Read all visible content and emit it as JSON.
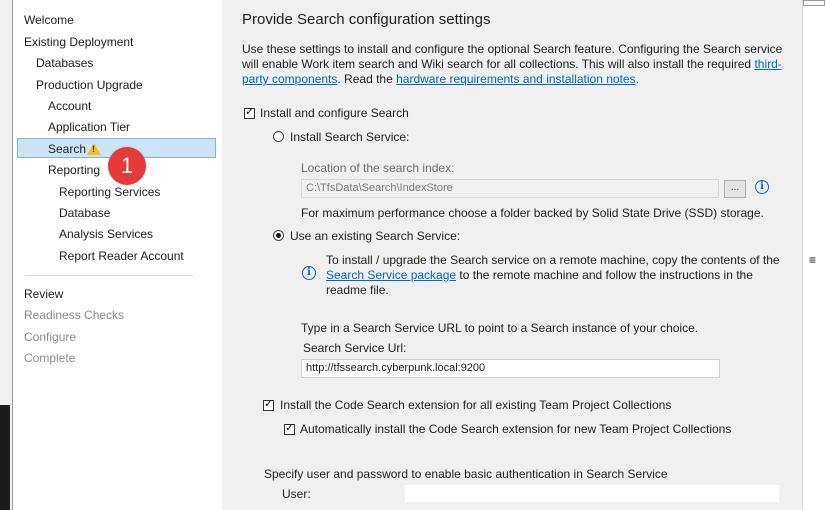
{
  "sidebar": {
    "items": [
      {
        "label": "Welcome"
      },
      {
        "label": "Existing Deployment"
      },
      {
        "label": "Databases"
      },
      {
        "label": "Production Upgrade"
      },
      {
        "label": "Account"
      },
      {
        "label": "Application Tier"
      },
      {
        "label": "Search",
        "selected": true,
        "warning_icon": "warning-icon"
      },
      {
        "label": "Reporting"
      },
      {
        "label": "Reporting Services"
      },
      {
        "label": "Database"
      },
      {
        "label": "Analysis Services"
      },
      {
        "label": "Report Reader Account"
      },
      {
        "label": "Review"
      },
      {
        "label": "Readiness Checks",
        "disabled": true
      },
      {
        "label": "Configure",
        "disabled": true
      },
      {
        "label": "Complete",
        "disabled": true
      }
    ]
  },
  "callout": {
    "number": "1",
    "color": "#e33a3a"
  },
  "main": {
    "heading": "Provide Search configuration settings",
    "intro": {
      "text_1": "Use these settings to install and configure the optional Search feature. Configuring the Search service will enable Work item search and Wiki search for all collections. This will also install the required ",
      "link_1": "third-party components",
      "text_2": ". Read the ",
      "link_2": "hardware requirements and installation notes",
      "text_3": "."
    },
    "install_search": {
      "label": "Install and configure Search",
      "checked": true
    },
    "install_service": {
      "label": "Install Search Service:",
      "selected": false
    },
    "index_location": {
      "label": "Location of the search index:",
      "value": "C:\\TfsData\\Search\\IndexStore",
      "browse_label": "...",
      "info_icon": "info-icon"
    },
    "ssd_note": "For maximum performance choose a folder backed by Solid State Drive (SSD) storage.",
    "use_existing": {
      "label": "Use an existing Search Service:",
      "selected": true
    },
    "remote_note": {
      "text_1": "To install / upgrade the Search service on a remote machine, copy the contents of the",
      "link": "Search Service package",
      "text_2": " to the remote machine and follow the instructions in the",
      "text_3": "readme file."
    },
    "url_hint": "Type in a Search Service URL to point to a Search instance of your choice.",
    "url": {
      "label": "Search Service Url:",
      "value": "http://tfssearch.cyberpunk.local:9200"
    },
    "code_search": {
      "label": "Install the Code Search extension for all existing Team Project Collections",
      "checked": true
    },
    "auto_code_search": {
      "label": "Automatically install the Code Search extension for new Team Project Collections",
      "checked": true
    },
    "auth_note": "Specify user and password to enable basic authentication in Search Service",
    "user": {
      "label": "User:",
      "value": ""
    }
  },
  "colors": {
    "accent": "#0066cc",
    "selection": "#cde4f7",
    "panel": "#f0f0f0",
    "warning": "#f1c40f"
  }
}
